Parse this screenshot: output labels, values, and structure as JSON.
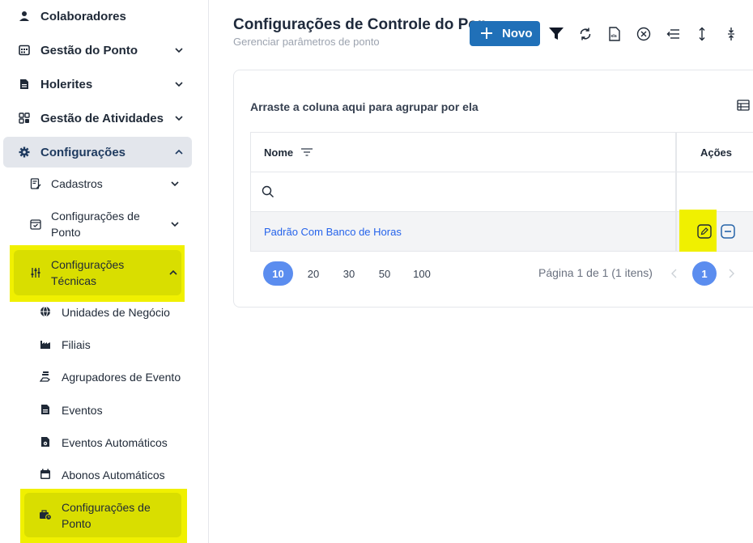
{
  "sidebar": {
    "colaboradores": "Colaboradores",
    "gestao_ponto": "Gestão do Ponto",
    "holerites": "Holerites",
    "gestao_atividades": "Gestão de Atividades",
    "configuracoes": "Configurações",
    "cadastros": "Cadastros",
    "config_ponto_1": "Configurações de",
    "config_ponto_2": "Ponto",
    "config_tecnicas_1": "Configurações",
    "config_tecnicas_2": "Técnicas",
    "unidades": "Unidades de Negócio",
    "filiais": "Filiais",
    "agrupadores": "Agrupadores de Evento",
    "eventos": "Eventos",
    "eventos_auto": "Eventos Automáticos",
    "abonos_auto": "Abonos Automáticos",
    "leaf_config_ponto_1": "Configurações de",
    "leaf_config_ponto_2": "Ponto"
  },
  "header": {
    "title": "Configurações de Controle do Pon",
    "subtitle": "Gerenciar parâmetros de ponto",
    "new_button": "Novo"
  },
  "grid": {
    "group_hint": "Arraste a coluna aqui para agrupar por ela",
    "col_name": "Nome",
    "col_actions": "Ações",
    "rows": [
      {
        "nome": "Padrão Com Banco de Horas"
      }
    ]
  },
  "pager": {
    "sizes": [
      "10",
      "20",
      "30",
      "50",
      "100"
    ],
    "info": "Página 1 de 1 (1 itens)",
    "current_page": "1"
  },
  "colors": {
    "primary": "#2070b8",
    "highlight": "#f0f000",
    "link": "#2563eb",
    "pager_active": "#5b8def"
  }
}
